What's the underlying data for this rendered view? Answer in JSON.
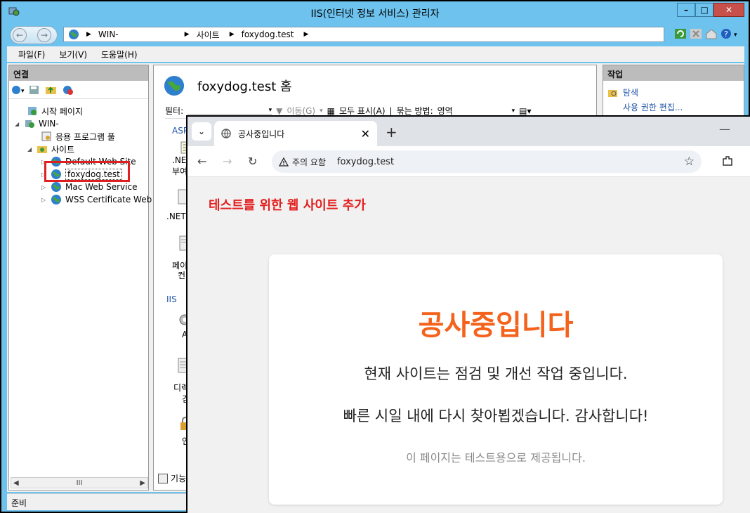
{
  "iis": {
    "title": "IIS(인터넷 정보 서비스) 관리자",
    "path": [
      "WIN-",
      "사이트",
      "foxydog.test"
    ],
    "menu": [
      "파일(F)",
      "보기(V)",
      "도움말(H)"
    ],
    "connections": {
      "header": "연결",
      "tree": {
        "start_page": "시작 페이지",
        "server": "WIN-",
        "app_pools": "응용 프로그램 풀",
        "sites": "사이트",
        "default_site": "Default Web Site",
        "foxydog": "foxydog.test",
        "mac_service": "Mac Web Service",
        "wss_cert": "WSS Certificate Web S"
      },
      "scroll_mark": "III"
    },
    "middle": {
      "title": "foxydog.test 홈",
      "filter_label": "필터:",
      "go_label": "이동(G)",
      "show_all": "모두 표시(A)",
      "group_by": "묶는 방법:",
      "group_value": "영역",
      "group_asp": "ASP",
      "item_net_1a": ".NET",
      "item_net_1b": "부여",
      "item_net_2": ".NET",
      "item_page_a": "페이",
      "item_page_b": "컨",
      "group_iis": "IIS",
      "item_a": "A",
      "item_dir_a": "디렉",
      "item_dir_b": "검",
      "item_in": "인",
      "features_view": "기능"
    },
    "actions": {
      "header": "작업",
      "explore": "탐색",
      "edit_perms": "사용 권한 편집..."
    },
    "status": "준비"
  },
  "browser": {
    "tab_title": "공사중입니다",
    "security_chip": "주의 요함",
    "url": "foxydog.test",
    "annotation": "테스트를 위한 웹 사이트 추가",
    "page": {
      "heading": "공사중입니다",
      "line1": "현재 사이트는 점검 및 개선 작업 중입니다.",
      "line2": "빠른 시일 내에 다시 찾아뵙겠습니다. 감사합니다!",
      "note": "이 페이지는 테스트용으로 제공됩니다."
    }
  },
  "colors": {
    "heading_orange": "#f4621c",
    "annotation_red": "#e41e1e",
    "iis_title_blue": "#6dc2ee"
  }
}
